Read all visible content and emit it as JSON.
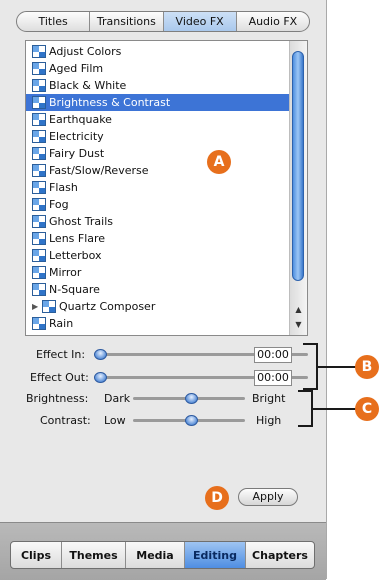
{
  "tabs": [
    {
      "label": "Titles",
      "active": false
    },
    {
      "label": "Transitions",
      "active": false
    },
    {
      "label": "Video FX",
      "active": true
    },
    {
      "label": "Audio FX",
      "active": false
    }
  ],
  "effects": [
    {
      "label": "Adjust Colors"
    },
    {
      "label": "Aged Film"
    },
    {
      "label": "Black & White"
    },
    {
      "label": "Brightness & Contrast",
      "selected": true
    },
    {
      "label": "Earthquake"
    },
    {
      "label": "Electricity"
    },
    {
      "label": "Fairy Dust"
    },
    {
      "label": "Fast/Slow/Reverse"
    },
    {
      "label": "Flash"
    },
    {
      "label": "Fog"
    },
    {
      "label": "Ghost Trails"
    },
    {
      "label": "Lens Flare"
    },
    {
      "label": "Letterbox"
    },
    {
      "label": "Mirror"
    },
    {
      "label": "N-Square"
    },
    {
      "label": "Quartz Composer",
      "expandable": true
    },
    {
      "label": "Rain"
    }
  ],
  "controls": {
    "effect_in_label": "Effect In:",
    "effect_in_value": "00:00",
    "effect_out_label": "Effect Out:",
    "effect_out_value": "00:00",
    "brightness_label": "Brightness:",
    "brightness_min": "Dark",
    "brightness_max": "Bright",
    "contrast_label": "Contrast:",
    "contrast_min": "Low",
    "contrast_max": "High"
  },
  "apply_label": "Apply",
  "bottom_tabs": [
    {
      "label": "Clips",
      "active": false
    },
    {
      "label": "Themes",
      "active": false
    },
    {
      "label": "Media",
      "active": false
    },
    {
      "label": "Editing",
      "active": true
    },
    {
      "label": "Chapters",
      "active": false
    }
  ],
  "callouts": {
    "a": "A",
    "b": "B",
    "c": "C",
    "d": "D"
  },
  "colors": {
    "accent": "#3d74d6",
    "callout": "#e76f1c"
  }
}
